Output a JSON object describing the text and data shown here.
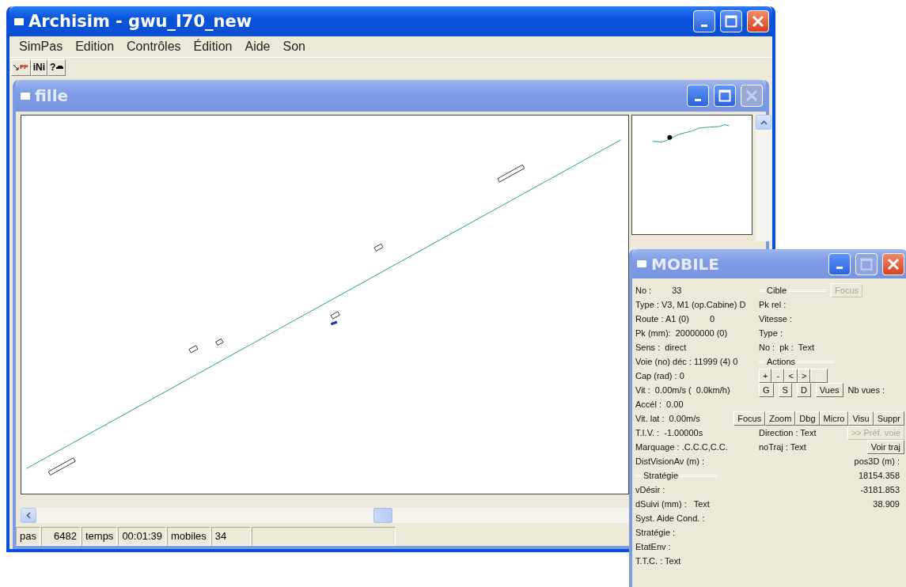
{
  "main_window": {
    "title": "Archisim - gwu_I70_new",
    "controls": [
      {
        "kind": "minimize",
        "disabled": false
      },
      {
        "kind": "maximize",
        "disabled": false
      },
      {
        "kind": "close",
        "disabled": false
      }
    ],
    "menu": [
      "SimPas",
      "Edition",
      "Contrôles",
      "Édition",
      "Aide",
      "Son"
    ],
    "toolbar": [
      {
        "kind": "pp",
        "label": "PP"
      },
      {
        "kind": "ini",
        "label": "iNi"
      },
      {
        "kind": "help",
        "label": "?"
      }
    ]
  },
  "child_window": {
    "title": "fille",
    "controls": [
      {
        "kind": "minimize",
        "disabled": false
      },
      {
        "kind": "maximize",
        "disabled": false
      },
      {
        "kind": "close",
        "disabled": true
      }
    ]
  },
  "status_bar": [
    "pas",
    "6482",
    "temps",
    "00:01:39",
    "mobiles",
    "34"
  ],
  "mobile_window": {
    "title": "MOBILE",
    "controls": [
      {
        "kind": "minimize",
        "disabled": false
      },
      {
        "kind": "maximize",
        "disabled": true
      },
      {
        "kind": "close",
        "disabled": false
      }
    ],
    "rows": [
      {
        "left": [
          {
            "kind": "text",
            "text": "No :"
          },
          {
            "kind": "text",
            "text": "33"
          }
        ],
        "right": [
          {
            "kind": "group",
            "text": "Cible"
          },
          {
            "kind": "button",
            "label": "Focus",
            "disabled": true
          }
        ]
      },
      {
        "left": [
          {
            "kind": "text",
            "text": "Type : V3, M1 (op.Cabine) D"
          }
        ],
        "right": [
          {
            "kind": "text",
            "text": "Pk rel :"
          }
        ]
      },
      {
        "left": [
          {
            "kind": "text",
            "text": "Route : A1 (0)"
          },
          {
            "kind": "text",
            "text": "0"
          }
        ],
        "right": [
          {
            "kind": "text",
            "text": "Vitesse :"
          }
        ]
      },
      {
        "left": [
          {
            "kind": "text",
            "text": "Pk (mm):  20000000 (0)"
          }
        ],
        "right": [
          {
            "kind": "text",
            "text": "Type :"
          }
        ]
      },
      {
        "left": [
          {
            "kind": "text",
            "text": "Sens :  direct"
          }
        ],
        "right": [
          {
            "kind": "text",
            "text": "No :"
          },
          {
            "kind": "text",
            "text": "pk :  Text"
          }
        ]
      },
      {
        "left": [
          {
            "kind": "text",
            "text": "Voie (no) déc : 11999 (4) 0"
          }
        ],
        "right": [
          {
            "kind": "group",
            "text": "Actions"
          }
        ]
      },
      {
        "left": [
          {
            "kind": "text",
            "text": "Cap (rad) : 0"
          }
        ],
        "right": [
          {
            "kind": "button",
            "label": "+",
            "disabled": false
          },
          {
            "kind": "button",
            "label": "-",
            "disabled": false
          },
          {
            "kind": "button",
            "label": "<",
            "disabled": false
          },
          {
            "kind": "button",
            "label": ">",
            "disabled": false
          },
          {
            "kind": "button",
            "disabled": false
          }
        ]
      },
      {
        "left": [
          {
            "kind": "text",
            "text": "Vit :  0.00m/s (  0.0km/h)"
          }
        ],
        "right": [
          {
            "kind": "button",
            "label": "G",
            "disabled": false
          },
          {
            "kind": "button",
            "label": "S",
            "disabled": false
          },
          {
            "kind": "button",
            "label": "D",
            "disabled": false
          },
          {
            "kind": "button",
            "label": "Vues",
            "disabled": false
          },
          {
            "kind": "text",
            "text": "Nb vues :"
          }
        ]
      },
      {
        "left": [
          {
            "kind": "text",
            "text": "Accél :  0.00"
          }
        ],
        "right": []
      },
      {
        "left": [
          {
            "kind": "text",
            "text": "Vit. lat :  0.00m/s"
          }
        ],
        "right": [
          {
            "kind": "button",
            "label": "Focus",
            "disabled": false
          },
          {
            "kind": "button",
            "label": "Zoom",
            "disabled": false
          },
          {
            "kind": "button",
            "label": "Dbg",
            "disabled": false
          },
          {
            "kind": "button",
            "label": "Micro",
            "disabled": false
          },
          {
            "kind": "button",
            "label": "Visu",
            "disabled": false
          },
          {
            "kind": "button",
            "label": "Suppr",
            "disabled": false
          }
        ]
      },
      {
        "left": [
          {
            "kind": "text",
            "text": "T.I.V. :  -1.00000s"
          }
        ],
        "right": [
          {
            "kind": "text",
            "text": "Direction : Text"
          },
          {
            "kind": "button",
            "label": ">> Préf. voie",
            "disabled": true
          }
        ]
      },
      {
        "left": [
          {
            "kind": "text",
            "text": "Marquage : .C.C.C,C.C."
          }
        ],
        "right": [
          {
            "kind": "text",
            "text": "noTraj : Text"
          },
          {
            "kind": "button",
            "label": "Voir traj",
            "disabled": false
          }
        ]
      },
      {
        "left": [
          {
            "kind": "text",
            "text": "DistVisionAv (m) :"
          }
        ],
        "right": [
          {
            "kind": "coord",
            "text": "pos3D (m) :"
          }
        ]
      },
      {
        "left": [
          {
            "kind": "group",
            "text": "Stratégie"
          }
        ],
        "right": [
          {
            "kind": "coord",
            "text": "18154.358"
          }
        ]
      },
      {
        "left": [
          {
            "kind": "text",
            "text": "vDésir :"
          }
        ],
        "right": [
          {
            "kind": "coord",
            "text": "-3181.853"
          }
        ]
      },
      {
        "left": [
          {
            "kind": "text",
            "text": "dSuivi (mm) :   Text"
          }
        ],
        "right": [
          {
            "kind": "coord",
            "text": "38.909"
          }
        ]
      },
      {
        "left": [
          {
            "kind": "text",
            "text": "Syst. Aide Cond. :"
          }
        ],
        "right": []
      },
      {
        "left": [
          {
            "kind": "text",
            "text": "Stratégie :"
          }
        ],
        "right": []
      },
      {
        "left": [
          {
            "kind": "text",
            "text": "EtatEnv :"
          }
        ],
        "right": []
      },
      {
        "left": [
          {
            "kind": "text",
            "text": "T.T.C. : Text"
          }
        ],
        "right": []
      }
    ]
  }
}
